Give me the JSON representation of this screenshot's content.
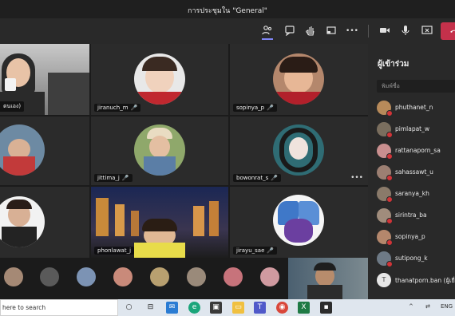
{
  "window": {
    "title": "การประชุมใน \"General\""
  },
  "toolbar": {
    "icons": [
      "participants-icon",
      "chat-icon",
      "raise-hand-icon",
      "share-tray-icon",
      "more-icon",
      "camera-icon",
      "mic-icon",
      "share-screen-icon",
      "hang-up-icon"
    ],
    "more_glyph": "•••"
  },
  "tiles": [
    {
      "name": "ตนเอง",
      "partial": "ตนเอง)"
    },
    {
      "name": "jiranuch_m"
    },
    {
      "name": "sopinya_p"
    },
    {
      "name": ""
    },
    {
      "name": "jittima_j"
    },
    {
      "name": "bowonrat_s"
    },
    {
      "name": ""
    },
    {
      "name": "phonlawat_j"
    },
    {
      "name": "jirayu_sae"
    }
  ],
  "panel": {
    "title": "ผู้เข้าร่วม",
    "search_placeholder": "พิมพ์ชื่อ",
    "participants": [
      {
        "name": "phuthanet_n"
      },
      {
        "name": "pimlapat_w"
      },
      {
        "name": "rattanaporn_sa"
      },
      {
        "name": "sahassawt_u"
      },
      {
        "name": "saranya_kh"
      },
      {
        "name": "sirintra_ba"
      },
      {
        "name": "sopinya_p"
      },
      {
        "name": "sutipong_k"
      },
      {
        "name": "thanatporn.ban (ผู้เยี่ยม",
        "initial": "T"
      }
    ]
  },
  "taskbar": {
    "search_text": "here to search",
    "lang": "ENG",
    "tray_caret": "^"
  },
  "colors": {
    "accent": "#c4314b",
    "status_red": "#d13438"
  }
}
